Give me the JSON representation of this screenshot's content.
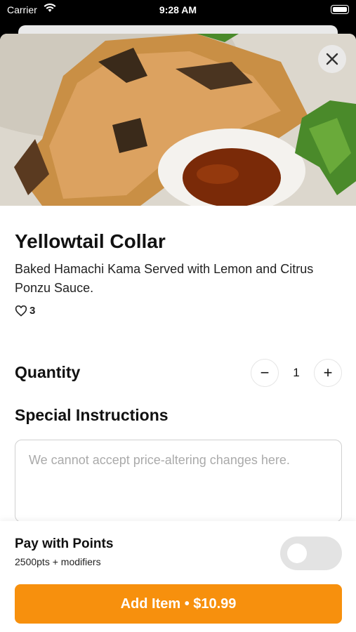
{
  "status_bar": {
    "carrier": "Carrier",
    "time": "9:28 AM"
  },
  "item": {
    "title": "Yellowtail Collar",
    "description": "Baked Hamachi Kama Served with Lemon and Citrus Ponzu Sauce.",
    "likes": "3"
  },
  "quantity": {
    "label": "Quantity",
    "value": "1",
    "minus": "−",
    "plus": "+"
  },
  "instructions": {
    "label": "Special Instructions",
    "placeholder": "We cannot accept price-altering changes here."
  },
  "points": {
    "title": "Pay with Points",
    "subtitle": "2500pts + modifiers",
    "enabled": false
  },
  "add_button": {
    "label": "Add Item • $10.99"
  },
  "icons": {
    "close": "close-icon",
    "heart": "heart-icon",
    "wifi": "wifi-icon",
    "battery": "battery-icon"
  },
  "colors": {
    "accent": "#f7900d",
    "toggle_off": "#e3e3e3"
  }
}
